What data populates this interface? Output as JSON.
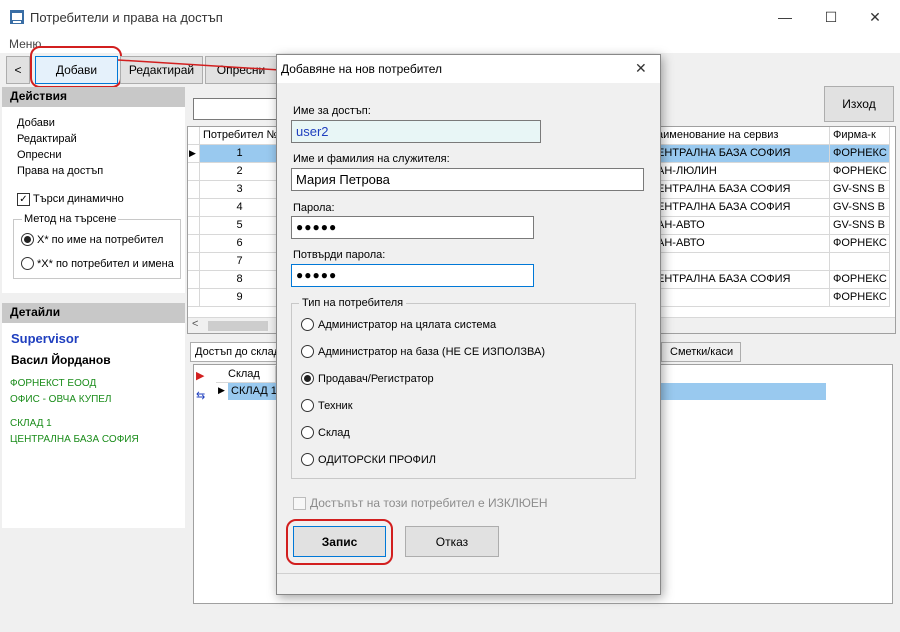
{
  "window": {
    "title": "Потребители и права на достъп"
  },
  "menu": {
    "label": "Меню"
  },
  "toolbar": {
    "back": "<",
    "add": "Добави",
    "edit": "Редактирай",
    "refresh": "Опресни",
    "exit": "Изход"
  },
  "actions": {
    "title": "Действия",
    "items": [
      "Добави",
      "Редактирай",
      "Опресни",
      "Права на достъп"
    ],
    "dynamic_search": "Търси динамично",
    "search_method": "Метод на търсене",
    "method_1": "Х* по име на потребител",
    "method_2": "*Х* по потребител и имена"
  },
  "details": {
    "title": "Детайли",
    "role": "Supervisor",
    "name": "Васил Йорданов",
    "company": "ФОРНЕКСТ ЕООД",
    "office": "ОФИС - ОВЧА КУПЕЛ",
    "warehouse": "СКЛАД 1",
    "base": "ЦЕНТРАЛНА БАЗА СОФИЯ"
  },
  "grid": {
    "col_user": "Потребител №",
    "col_service": "аименование на сервиз",
    "col_company": "Фирма-к",
    "rows": [
      {
        "n": "1",
        "service": "ЕНТРАЛНА БАЗА СОФИЯ",
        "company": "ФОРНЕКС"
      },
      {
        "n": "2",
        "service": "АН-ЛЮЛИН",
        "company": "ФОРНЕКС"
      },
      {
        "n": "3",
        "service": "ЕНТРАЛНА БАЗА СОФИЯ",
        "company": "GV-SNS В"
      },
      {
        "n": "4",
        "service": "ЕНТРАЛНА БАЗА СОФИЯ",
        "company": "GV-SNS В"
      },
      {
        "n": "5",
        "service": "АН-АВТО",
        "company": "GV-SNS В"
      },
      {
        "n": "6",
        "service": "АН-АВТО",
        "company": "ФОРНЕКС"
      },
      {
        "n": "7",
        "service": "",
        "company": ""
      },
      {
        "n": "8",
        "service": "ЕНТРАЛНА БАЗА СОФИЯ",
        "company": "ФОРНЕКС"
      },
      {
        "n": "9",
        "service": "",
        "company": "ФОРНЕКС"
      }
    ]
  },
  "lower": {
    "tab_access": "Достъп до склад",
    "tab_accounts": "Сметки/каси",
    "col_warehouse": "Склад",
    "row_1": "СКЛАД 1"
  },
  "dialog": {
    "title": "Добавяне на нов потребител",
    "username_label": "Име за достъп:",
    "username_value": "user2",
    "fullname_label": "Име и фамилия на служителя:",
    "fullname_value": "Мария Петрова",
    "password_label": "Парола:",
    "password_value": "●●●●●",
    "confirm_label": "Потвърди парола:",
    "confirm_value": "●●●●●",
    "type_group": "Тип на потребителя",
    "types": [
      "Администратор на цялата система",
      "Администратор на база (НЕ СЕ ИЗПОЛЗВА)",
      "Продавач/Регистратор",
      "Техник",
      "Склад",
      "ОДИТОРСКИ ПРОФИЛ"
    ],
    "selected_type": "Продавач/Регистратор",
    "disabled_label": "Достъпът на този потребител е ИЗКЛЮЕН",
    "save": "Запис",
    "cancel": "Отказ"
  },
  "colors": {
    "accent": "#0078d7",
    "selection": "#99c9ef",
    "highlight": "#d21f1f",
    "green_text": "#1a8c1a",
    "role_blue": "#1f3fbf"
  }
}
